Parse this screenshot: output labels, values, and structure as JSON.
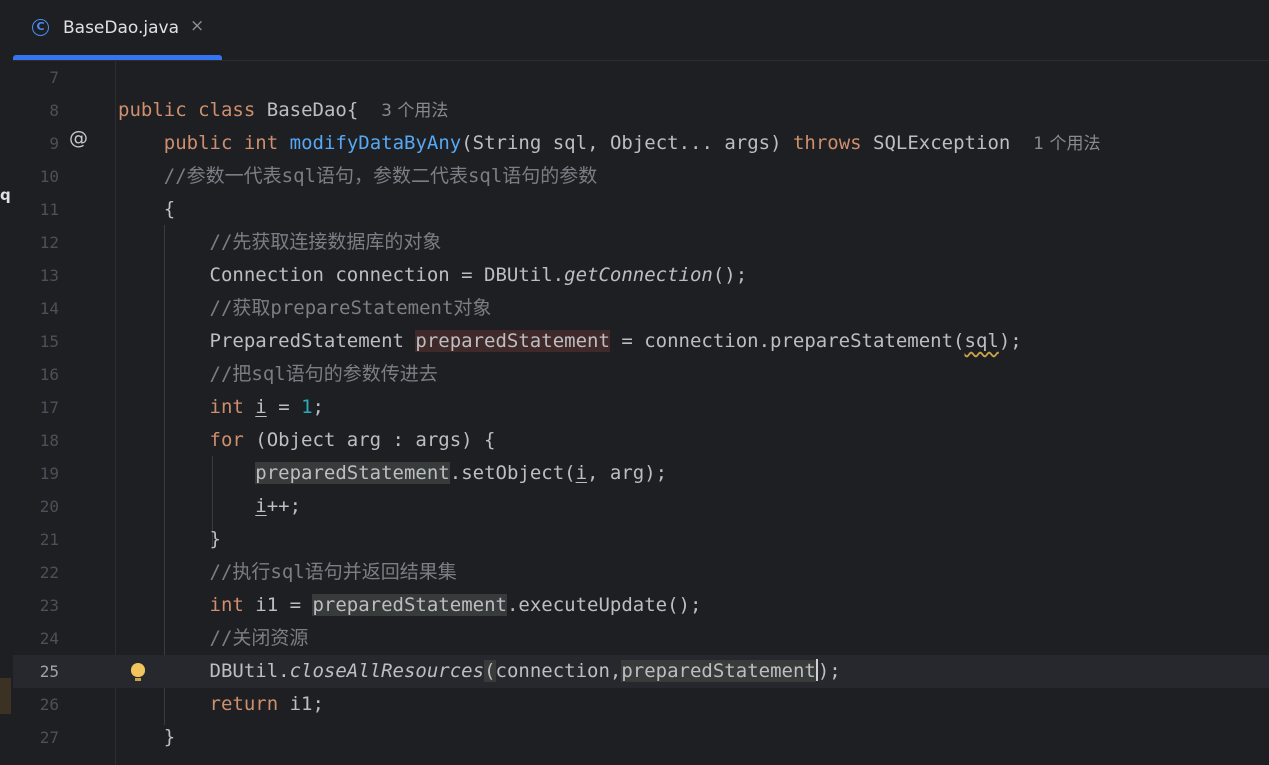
{
  "tab": {
    "title": "BaseDao.java",
    "icon": "java-class-icon",
    "close": "×"
  },
  "sidebar": {
    "glyph": "q"
  },
  "hints": {
    "class_usages": "3 个用法",
    "method_usages": "1 个用法"
  },
  "gutter": {
    "at_symbol": "@"
  },
  "lines": {
    "l7": "7",
    "l8": "8",
    "l9": "9",
    "l10": "10",
    "l11": "11",
    "l12": "12",
    "l13": "13",
    "l14": "14",
    "l15": "15",
    "l16": "16",
    "l17": "17",
    "l18": "18",
    "l19": "19",
    "l20": "20",
    "l21": "21",
    "l22": "22",
    "l23": "23",
    "l24": "24",
    "l25": "25",
    "l26": "26",
    "l27": "27"
  },
  "code": {
    "kw_public": "public",
    "kw_class": "class",
    "class_name": "BaseDao{",
    "kw_int": "int",
    "method_name": "modifyDataByAny",
    "params": "(String sql, Object... args) ",
    "kw_throws": "throws",
    "exception": " SQLException",
    "comment_10": "//参数一代表sql语句，参数二代表sql语句的参数",
    "open_brace": "{",
    "comment_12": "//先获取连接数据库的对象",
    "l13_a": "Connection connection = DBUtil.",
    "l13_b": "getConnection",
    "l13_c": "();",
    "comment_14": "//获取prepareStatement对象",
    "l15_a": "PreparedStatement ",
    "l15_b": "preparedStatement",
    "l15_c": " = connection.prepareStatement(",
    "l15_d": "sql",
    "l15_e": ");",
    "comment_16": "//把sql语句的参数传进去",
    "l17_var": "i",
    "l17_eq": " = ",
    "l17_num": "1",
    "l17_end": ";",
    "kw_for": "for",
    "l18_rest": " (Object arg : args) {",
    "l19_a": "preparedStatement",
    "l19_b": ".setObject(",
    "l19_c": "i",
    "l19_d": ", arg);",
    "l20_a": "i",
    "l20_b": "++;",
    "close_brace": "}",
    "comment_22": "//执行sql语句并返回结果集",
    "l23_a": " i1 = ",
    "l23_b": "preparedStatement",
    "l23_c": ".executeUpdate();",
    "comment_24": "//关闭资源",
    "l25_a": "DBUtil.",
    "l25_b": "closeAllResources",
    "l25_c": "(",
    "l25_d": "connection,",
    "l25_e": "preparedStatement",
    "l25_f": ");",
    "kw_return": "return",
    "l26_rest": " i1;"
  },
  "colors": {
    "keyword": "#cf8e6d",
    "method": "#56a8f5",
    "number": "#2aacb8",
    "comment": "#7a7e85",
    "text": "#bcbec4",
    "accent": "#3574f0"
  }
}
